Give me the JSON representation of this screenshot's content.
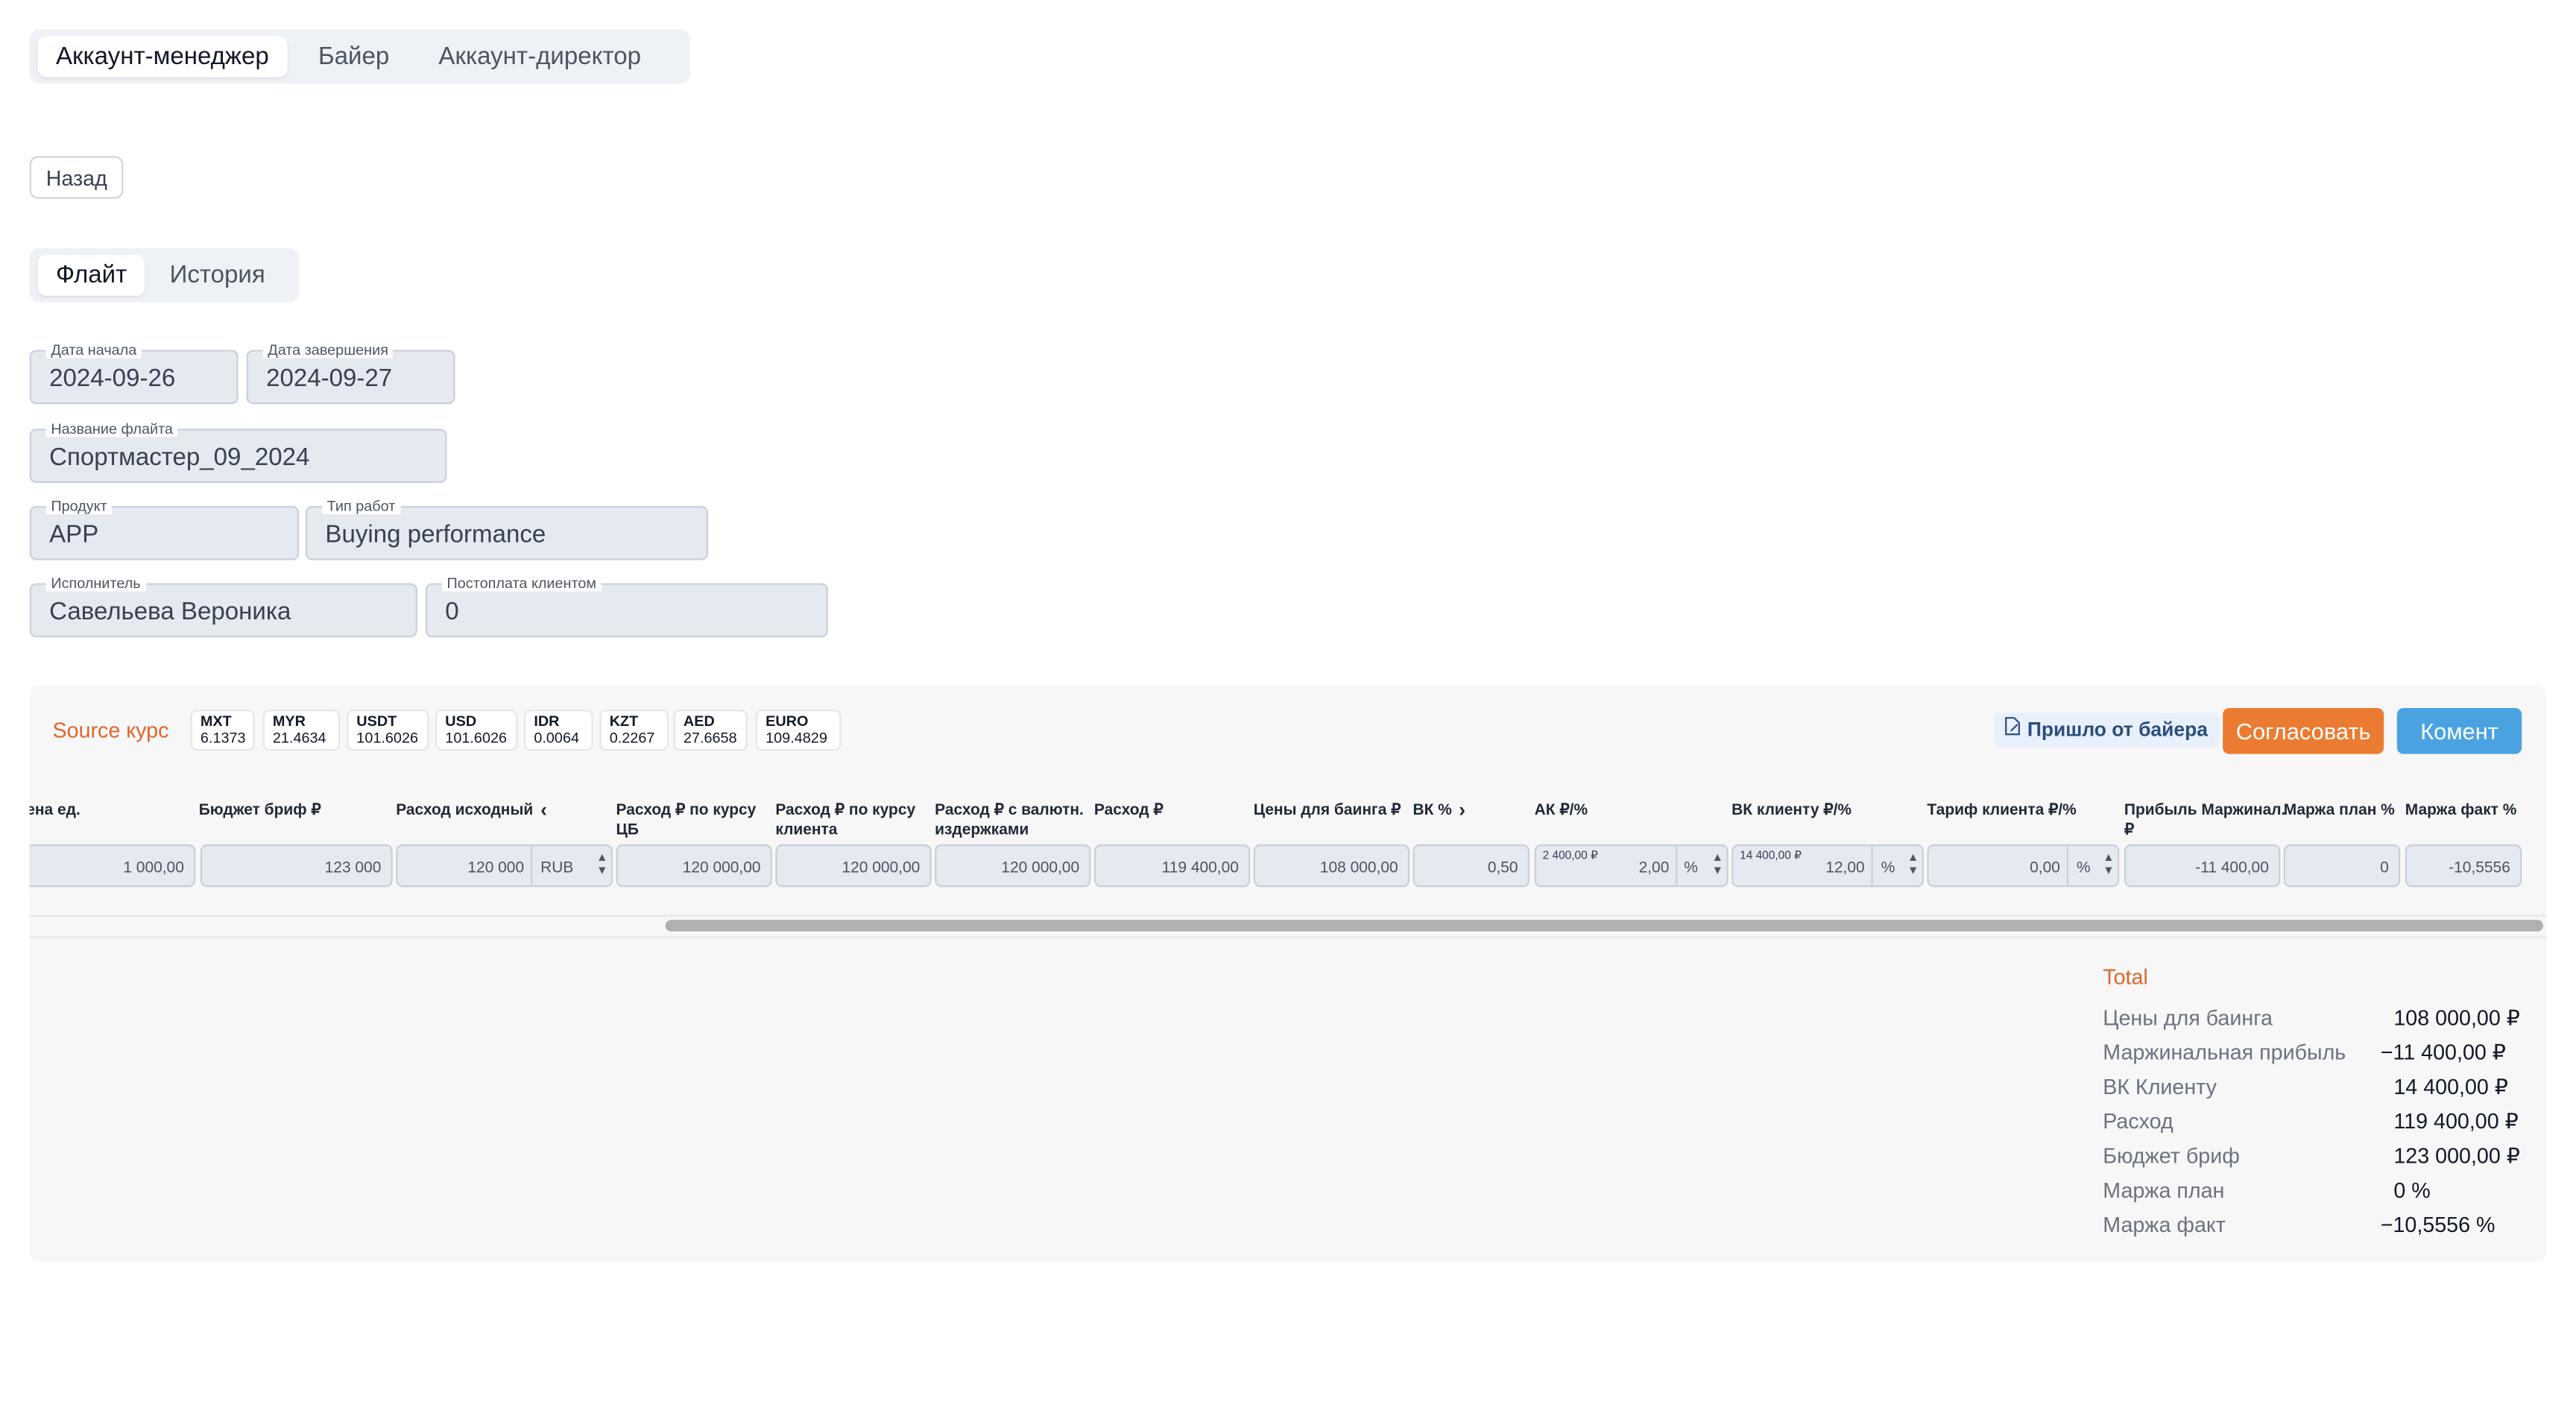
{
  "role_tabs": [
    "Аккаунт-менеджер",
    "Байер",
    "Аккаунт-директор"
  ],
  "back_label": "Назад",
  "view_tabs": [
    "Флайт",
    "История"
  ],
  "form": {
    "start_date": {
      "label": "Дата начала",
      "value": "2024-09-26"
    },
    "end_date": {
      "label": "Дата завершения",
      "value": "2024-09-27"
    },
    "flight_name": {
      "label": "Название флайта",
      "value": "Спортмастер_09_2024"
    },
    "product": {
      "label": "Продукт",
      "value": "APP"
    },
    "work_type": {
      "label": "Тип работ",
      "value": "Buying performance"
    },
    "executor": {
      "label": "Исполнитель",
      "value": "Савельева Вероника"
    },
    "postpay": {
      "label": "Постоплата клиентом",
      "value": "0"
    }
  },
  "rates": {
    "title": "Source курс",
    "items": [
      {
        "code": "MXT",
        "value": "6.1373"
      },
      {
        "code": "MYR",
        "value": "21.4634"
      },
      {
        "code": "USDT",
        "value": "101.6026"
      },
      {
        "code": "USD",
        "value": "101.6026"
      },
      {
        "code": "IDR",
        "value": "0.0064"
      },
      {
        "code": "KZT",
        "value": "0.2267"
      },
      {
        "code": "AED",
        "value": "27.6658"
      },
      {
        "code": "EURO",
        "value": "109.4829"
      }
    ]
  },
  "actions": {
    "buyer_badge": "Пришло от байера",
    "approve": "Согласовать",
    "comment": "Комент"
  },
  "table": {
    "headers": {
      "unit_price": "ена ед.",
      "brief_budget": "Бюджет бриф ₽",
      "spend_source": "Расход исходный",
      "spend_cb_1": "Расход ₽ по курсу",
      "spend_cb_2": "ЦБ",
      "spend_client_1": "Расход ₽ по курсу",
      "spend_client_2": "клиента",
      "spend_fx_1": "Расход ₽ с валютн.",
      "spend_fx_2": "издержками",
      "spend": "Расход ₽",
      "buying_price": "Цены для баинга ₽",
      "vk": "ВК %",
      "ak": "АК ₽/%",
      "vk_client": "ВК клиенту ₽/%",
      "client_tariff": "Тариф клиента ₽/%",
      "profit_1": "Прибыль Маржинал.",
      "profit_2": "₽",
      "margin_plan": "Маржа план %",
      "margin_fact": "Маржа факт %"
    },
    "row": {
      "unit_price": "1 000,00",
      "brief_budget": "123 000",
      "spend_source": "120 000",
      "currency": "RUB",
      "spend_cb": "120 000,00",
      "spend_client": "120 000,00",
      "spend_fx": "120 000,00",
      "spend": "119 400,00",
      "buying_price": "108 000,00",
      "vk": "0,50",
      "ak_tiny": "2 400,00 ₽",
      "ak": "2,00",
      "ak_unit": "%",
      "vk_client_tiny": "14 400,00 ₽",
      "vk_client": "12,00",
      "vk_client_unit": "%",
      "client_tariff": "0,00",
      "client_tariff_unit": "%",
      "profit": "-11 400,00",
      "margin_plan": "0",
      "margin_fact": "-10,5556"
    }
  },
  "totals": {
    "title": "Total",
    "items": [
      {
        "label": "Цены для баинга",
        "value": "108 000,00 ₽"
      },
      {
        "label": "Маржинальная прибыль",
        "value": "−11 400,00 ₽"
      },
      {
        "label": "ВК Клиенту",
        "value": "14 400,00 ₽"
      },
      {
        "label": "Расход",
        "value": "119 400,00 ₽"
      },
      {
        "label": "Бюджет бриф",
        "value": "123 000,00 ₽"
      },
      {
        "label": "Маржа план",
        "value": "0 %"
      },
      {
        "label": "Маржа факт",
        "value": "−10,5556 %"
      }
    ]
  },
  "colors": {
    "accent_orange": "#ec7b32",
    "accent_blue": "#4aa3e0",
    "source_title": "#e0662b"
  }
}
